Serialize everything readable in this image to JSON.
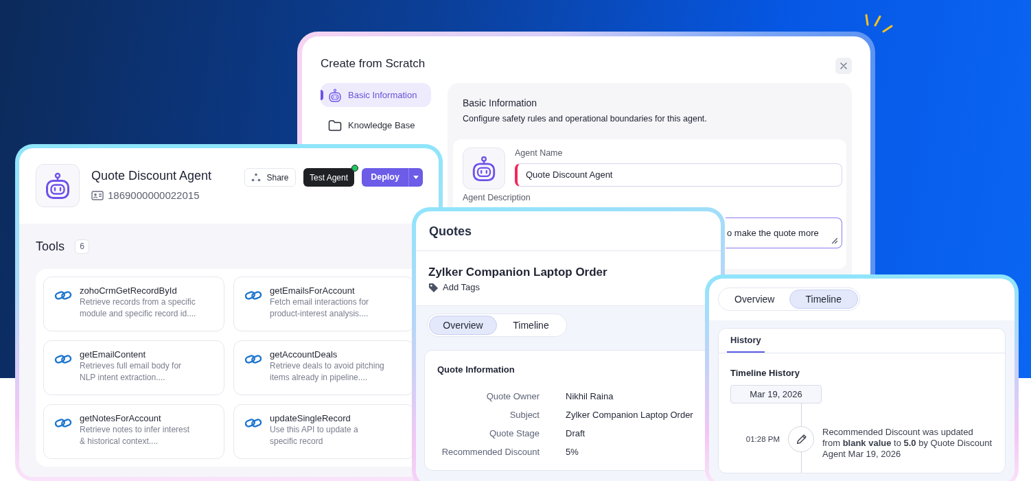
{
  "create_window": {
    "title": "Create from Scratch",
    "nav": [
      {
        "label": "Basic Information",
        "selected": true
      },
      {
        "label": "Knowledge Base",
        "selected": false
      }
    ],
    "section": {
      "title": "Basic Information",
      "description": "Configure safety rules and operational boundaries for this agent."
    },
    "agent_name": {
      "label": "Agent Name",
      "value": "Quote Discount Agent",
      "required": true
    },
    "agent_description": {
      "label": "Agent Description",
      "value": "o make the quote more",
      "focused": true
    }
  },
  "agent": {
    "name": "Quote Discount Agent",
    "id": "1869000000022015",
    "actions": [
      {
        "label": "Share",
        "kind": "share",
        "online": false
      },
      {
        "label": "Test Agent",
        "kind": "dark",
        "online": true
      },
      {
        "label": "Deploy",
        "kind": "split",
        "online": false
      }
    ]
  },
  "tools": {
    "title": "Tools",
    "count": "6",
    "items": [
      {
        "name": "zohoCrmGetRecordById",
        "description": "Retrieve records from a specific module and specific record id...."
      },
      {
        "name": "getEmailsForAccount",
        "description": "Fetch email interactions for product-interest analysis...."
      },
      {
        "name": "getEmailContent",
        "description": "Retrieves full email body for NLP intent extraction...."
      },
      {
        "name": "getAccountDeals",
        "description": "Retrieve deals to avoid pitching items already in pipeline...."
      },
      {
        "name": "getNotesForAccount",
        "description": "Retrieve notes to infer interest & historical context...."
      },
      {
        "name": "updateSingleRecord",
        "description": "Use this API to update a specific record"
      }
    ]
  },
  "quotes": {
    "title": "Quotes",
    "record_title": "Zylker Companion Laptop Order",
    "tag_action": "Add Tags",
    "tabs": [
      {
        "label": "Overview",
        "selected": true
      },
      {
        "label": "Timeline",
        "selected": false
      }
    ],
    "section_title": "Quote Information",
    "fields": [
      {
        "label": "Quote Owner",
        "value": "Nikhil Raina"
      },
      {
        "label": "Subject",
        "value": "Zylker Companion Laptop Order"
      },
      {
        "label": "Quote Stage",
        "value": "Draft"
      },
      {
        "label": "Recommended Discount",
        "value": "5%"
      }
    ]
  },
  "timeline_panel": {
    "tabs": [
      {
        "label": "Overview",
        "selected": false
      },
      {
        "label": "Timeline",
        "selected": true
      }
    ],
    "subtabs": [
      {
        "label": "History",
        "selected": true
      }
    ],
    "section_title": "Timeline History",
    "date": "Mar 19, 2026",
    "entries": [
      {
        "time": "01:28 PM",
        "text": "Recommended Discount was updated from **blank value** to **5.0** by Quote Discount Agent Mar 19, 2026"
      }
    ]
  }
}
